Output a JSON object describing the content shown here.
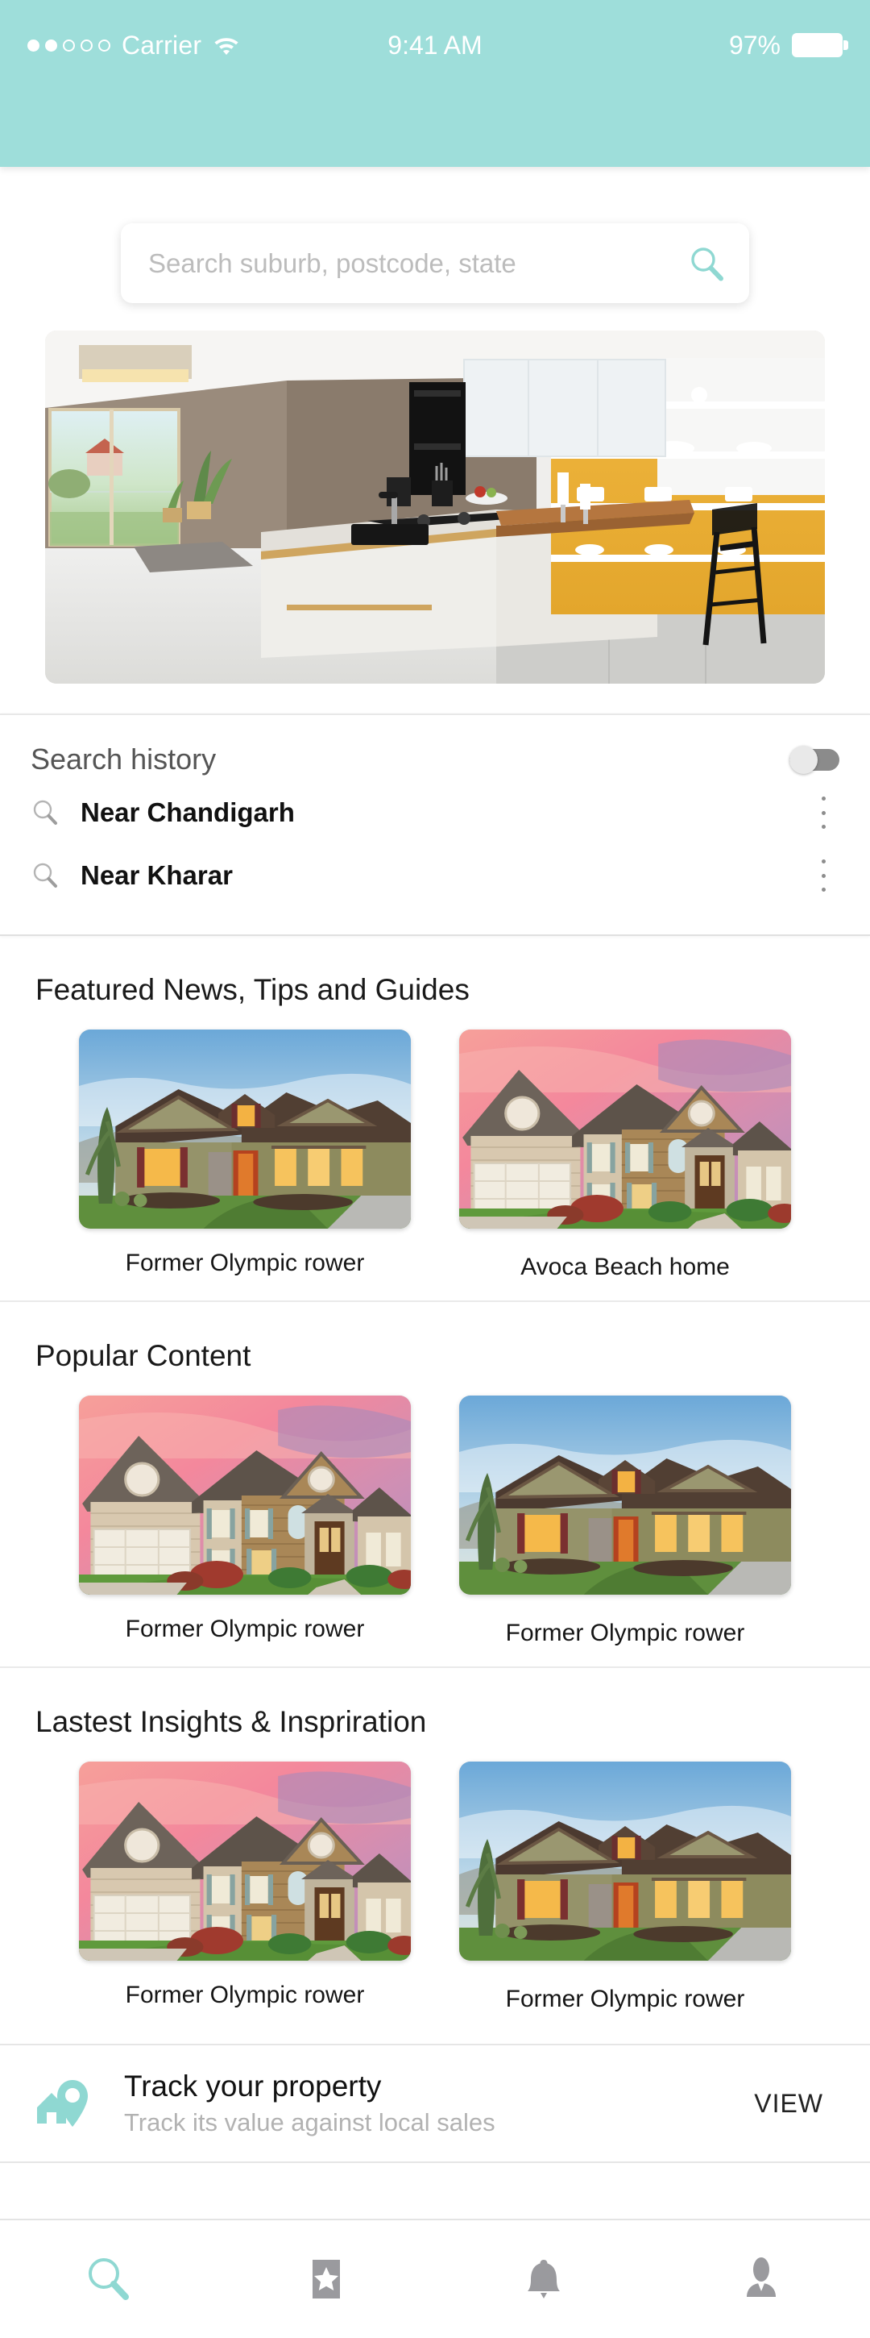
{
  "status_bar": {
    "carrier": "Carrier",
    "signal_bars_filled": 2,
    "signal_bars_total": 5,
    "wifi_icon": "wifi-icon",
    "time": "9:41 AM",
    "battery_percent": "97%",
    "background_color": "#9ededa"
  },
  "search": {
    "placeholder": "Search suburb, postcode, state",
    "value": "",
    "icon": "search-icon"
  },
  "hero": {
    "alt": "modern-kitchen-interior"
  },
  "search_history": {
    "title": "Search history",
    "toggle_on": false,
    "items": [
      {
        "label": "Near Chandigarh",
        "icon": "search-icon",
        "menu_icon": "kebab-menu-icon"
      },
      {
        "label": "Near Kharar",
        "icon": "search-icon",
        "menu_icon": "kebab-menu-icon"
      }
    ]
  },
  "sections": [
    {
      "title": "Featured News, Tips and Guides",
      "cards": [
        {
          "caption": "Former Olympic rower",
          "image": "craftsman-house-dusk"
        },
        {
          "caption": "Avoca Beach home",
          "image": "two-story-house-sunset"
        }
      ]
    },
    {
      "title": "Popular Content",
      "cards": [
        {
          "caption": "Former Olympic rower",
          "image": "two-story-house-sunset"
        },
        {
          "caption": "Former Olympic rower",
          "image": "craftsman-house-dusk"
        }
      ]
    },
    {
      "title": "Lastest Insights & Inspriration",
      "cards": [
        {
          "caption": "Former Olympic rower",
          "image": "two-story-house-sunset"
        },
        {
          "caption": "Former Olympic rower",
          "image": "craftsman-house-dusk"
        }
      ]
    }
  ],
  "track_banner": {
    "icon": "house-pin-icon",
    "title": "Track your property",
    "subtitle": "Track its value against local sales",
    "action_label": "VIEW"
  },
  "bottom_nav": {
    "items": [
      {
        "icon": "search-icon",
        "active": true
      },
      {
        "icon": "bookmark-star-icon",
        "active": false
      },
      {
        "icon": "bell-icon",
        "active": false
      },
      {
        "icon": "person-icon",
        "active": false
      }
    ],
    "active_color": "#8fd8d2",
    "inactive_color": "#9a9a9e"
  }
}
